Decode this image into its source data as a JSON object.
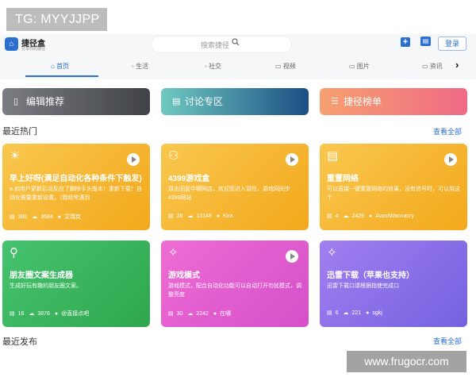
{
  "watermark_top": "TG: MYYJJPP",
  "watermark_bottom": "www.frugocr.com",
  "header": {
    "brand": "捷径盒",
    "brand_sub": "分享你的捷径",
    "search_placeholder": "搜索捷径",
    "login_label": "登录",
    "logo_glyph": "⌂",
    "plus_glyph": "+",
    "msg_glyph": "▤"
  },
  "tabs": [
    {
      "label": "首页",
      "icon": "home-icon",
      "active": true
    },
    {
      "label": "生活",
      "icon": "life-icon"
    },
    {
      "label": "社交",
      "icon": "social-icon"
    },
    {
      "label": "视频",
      "icon": "video-icon"
    },
    {
      "label": "图片",
      "icon": "image-icon"
    },
    {
      "label": "资讯",
      "icon": "news-icon"
    }
  ],
  "categories": [
    {
      "label": "编辑推荐",
      "icon": "bookmark-icon"
    },
    {
      "label": "讨论专区",
      "icon": "chat-icon"
    },
    {
      "label": "捷径榜单",
      "icon": "list-icon"
    }
  ],
  "sections": {
    "hot_title": "最近热门",
    "hot_see_all": "查看全部",
    "new_title": "最近发布",
    "new_see_all": "查看全部"
  },
  "cards": [
    {
      "title": "早上好呀(满足自动化各种条件下触发)",
      "desc": "a.如用户更新后没反应了删除手头版本！重新下载！自动化需要重新设置。（我经常遇到",
      "comments": "380",
      "downloads": "3684",
      "author": "艾瑞克",
      "icon": "sun-icon",
      "play": true,
      "color": "yellow"
    },
    {
      "title": "4399游戏盒",
      "desc": "双击回复中聊网店，欢迎您进入冒险，游戏网同步4399网站",
      "comments": "28",
      "downloads": "13148",
      "author": "Kira",
      "icon": "gamepad-icon",
      "play": true,
      "color": "yellow"
    },
    {
      "title": "重置网络",
      "desc": "可以直接一键重置网络的效果，没有信号时，可以用这个",
      "comments": "4",
      "downloads": "2429",
      "author": "AvastWannacry",
      "icon": "document-icon",
      "play": true,
      "color": "yellow"
    },
    {
      "title": "朋友圈文案生成器",
      "desc": "生成好玩有趣的朋友圈文案。",
      "comments": "16",
      "downloads": "3876",
      "author": "@直接点吧",
      "icon": "location-icon",
      "play": false,
      "color": "green"
    },
    {
      "title": "游戏模式",
      "desc": "游戏模式，配合自动化功能可以自动打开勿扰模式，调整亮度",
      "comments": "30",
      "downloads": "2242",
      "author": "在哪",
      "icon": "magic-wand-icon",
      "play": true,
      "color": "pink"
    },
    {
      "title": "迅雷下载（苹果也支持）",
      "desc": "迅雷下载口请根据指使完成口",
      "comments": "6",
      "downloads": "221",
      "author": "sgkj",
      "icon": "magic-wand-icon",
      "play": false,
      "color": "purple"
    }
  ]
}
